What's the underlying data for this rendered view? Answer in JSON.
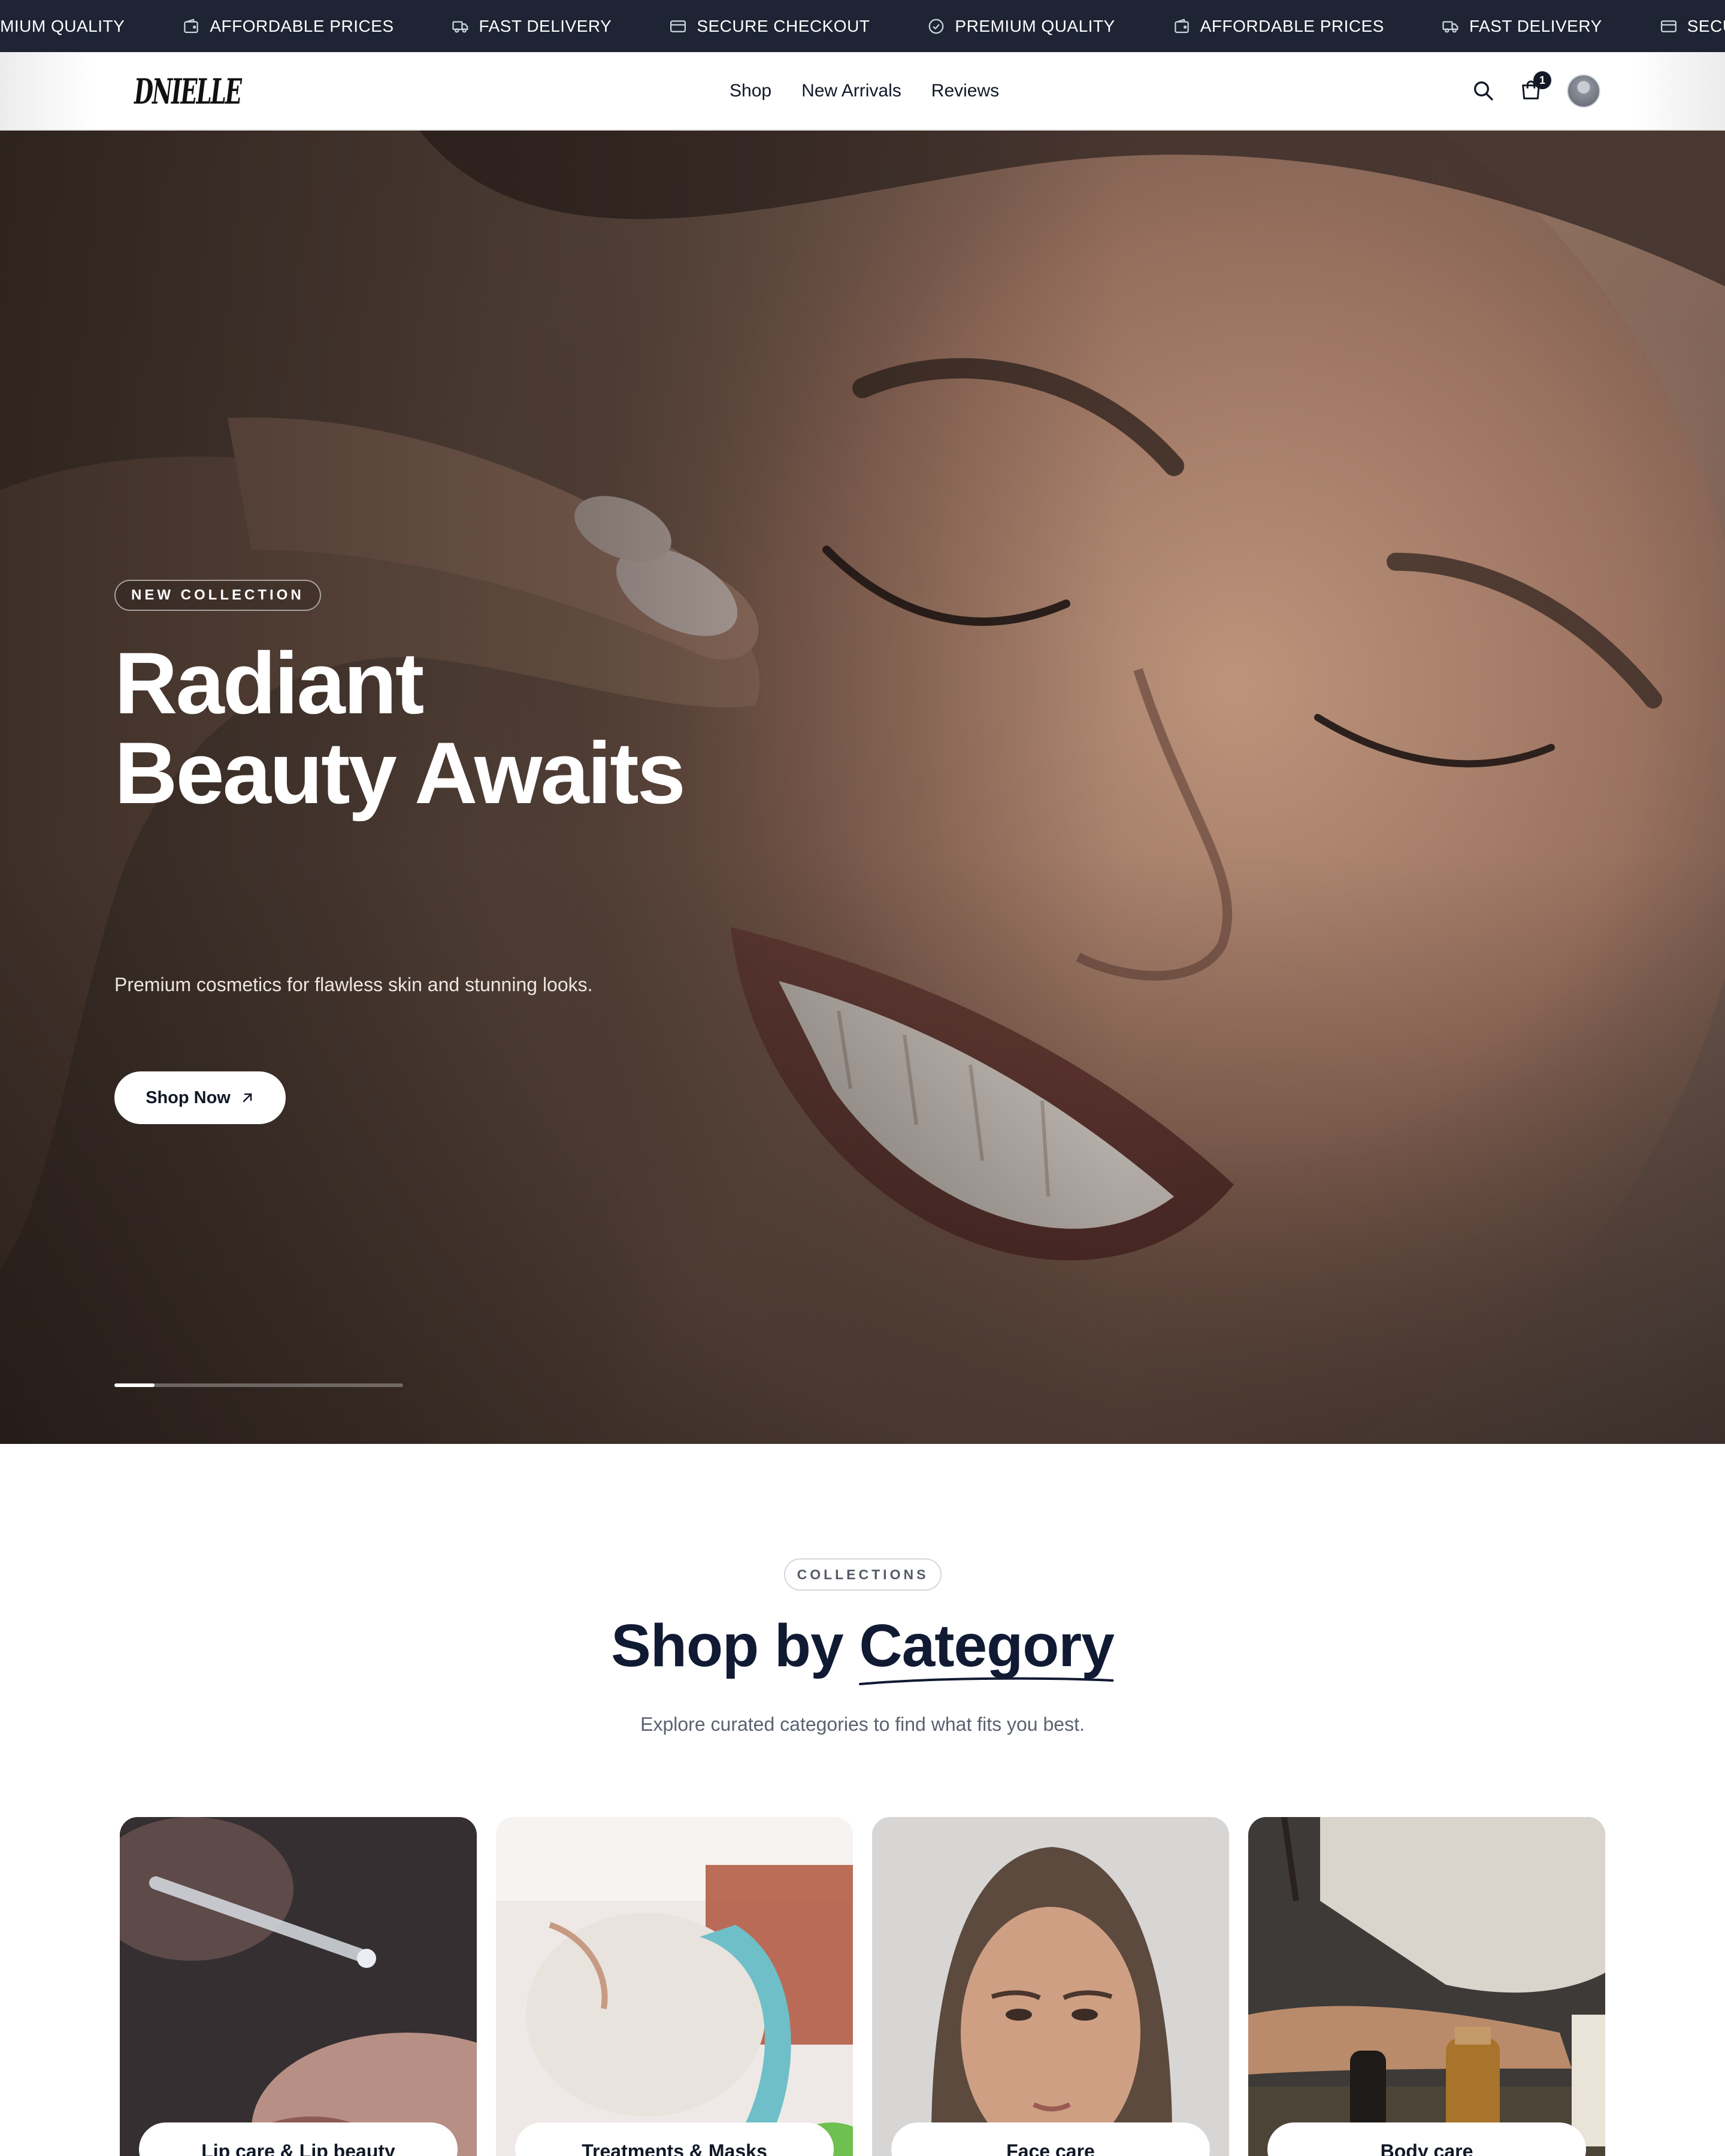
{
  "marquee": {
    "items": [
      {
        "label": "PREMIUM QUALITY",
        "icon": "check-circle-icon"
      },
      {
        "label": "AFFORDABLE PRICES",
        "icon": "wallet-icon"
      },
      {
        "label": "FAST DELIVERY",
        "icon": "truck-icon"
      },
      {
        "label": "SECURE CHECKOUT",
        "icon": "credit-card-icon"
      },
      {
        "label": "PREMIUM QUALITY",
        "icon": "check-circle-icon"
      },
      {
        "label": "AFFORDABLE PRICES",
        "icon": "wallet-icon"
      },
      {
        "label": "FAST DELIVERY",
        "icon": "truck-icon"
      },
      {
        "label": "SECURE CHECKOUT",
        "icon": "credit-card-icon"
      }
    ]
  },
  "header": {
    "brand": "DNIELLE",
    "nav": [
      "Shop",
      "New Arrivals",
      "Reviews"
    ],
    "cart_count": "1",
    "icons": {
      "search": "search-icon",
      "cart": "shopping-bag-icon",
      "profile": "avatar"
    }
  },
  "hero": {
    "badge": "NEW COLLECTION",
    "title_line1": "Radiant",
    "title_line2": "Beauty Awaits",
    "subtitle": "Premium cosmetics for flawless skin and stunning looks.",
    "cta": "Shop Now",
    "slide_progress": 0.14
  },
  "collections": {
    "badge": "COLLECTIONS",
    "title_prefix": "Shop by",
    "title_accent": "Category",
    "subtitle": "Explore curated categories to find what fits you best.",
    "categories": [
      {
        "label": "Lip care & Lip beauty"
      },
      {
        "label": "Treatments & Masks"
      },
      {
        "label": "Face care"
      },
      {
        "label": "Body care"
      }
    ]
  },
  "colors": {
    "marquee_bg": "#1e2433",
    "heading": "#111a33",
    "accent_dark": "#111827"
  }
}
